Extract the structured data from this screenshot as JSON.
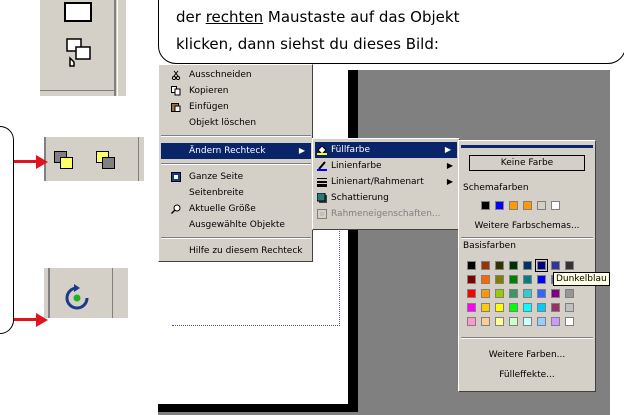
{
  "bubble": {
    "line1_pre": "der ",
    "line1_under": "rechten",
    "line1_post": " Maustaste auf das Objekt",
    "line2": "klicken, dann siehst du dieses Bild:"
  },
  "context_menu": {
    "items": [
      {
        "label": "Ausschneiden",
        "icon": "scissors-icon"
      },
      {
        "label": "Kopieren",
        "icon": "copy-icon"
      },
      {
        "label": "Einfügen",
        "icon": "paste-icon"
      },
      {
        "label": "Objekt löschen",
        "icon": ""
      },
      {
        "label": "Ändern Rechteck",
        "icon": ""
      },
      {
        "label": "Ganze Seite",
        "icon": "page-icon"
      },
      {
        "label": "Seitenbreite",
        "icon": ""
      },
      {
        "label": "Aktuelle Größe",
        "icon": "magnifier-icon"
      },
      {
        "label": "Ausgewählte Objekte",
        "icon": ""
      },
      {
        "label": "Hilfe zu diesem Rechteck",
        "icon": ""
      }
    ]
  },
  "submenu": {
    "items": [
      {
        "label": "Füllfarbe"
      },
      {
        "label": "Linienfarbe"
      },
      {
        "label": "Linienart/Rahmenart"
      },
      {
        "label": "Schattierung"
      },
      {
        "label": "Rahmeneigenschaften..."
      }
    ]
  },
  "palette": {
    "keine": "Keine Farbe",
    "schema_title": "Schemafarben",
    "weitere_schemas": "Weitere Farbschemas...",
    "basis_title": "Basisfarben",
    "tooltip": "Dunkelblau",
    "weitere_farben": "Weitere Farben...",
    "fuelleffekte": "Fülleffekte...",
    "schema_colors": [
      "#000000",
      "#0000ff",
      "#ff9900",
      "#ff9900",
      "#d4d0c8",
      "#ffffff"
    ],
    "basis_colors": [
      [
        "#000000",
        "#993300",
        "#333300",
        "#003300",
        "#003366",
        "#000080",
        "#333399",
        "#333333"
      ],
      [
        "#800000",
        "#ff6600",
        "#808000",
        "#008000",
        "#008080",
        "#0000ff",
        "#666699",
        "#808080"
      ],
      [
        "#ff0000",
        "#ff9900",
        "#99cc00",
        "#339966",
        "#33cccc",
        "#3366ff",
        "#800080",
        "#969696"
      ],
      [
        "#ff00ff",
        "#ffcc00",
        "#ffff00",
        "#00ff00",
        "#00ffff",
        "#00ccff",
        "#993366",
        "#c0c0c0"
      ],
      [
        "#ff99cc",
        "#ffcc99",
        "#ffff99",
        "#ccffcc",
        "#ccffff",
        "#99ccff",
        "#cc99ff",
        "#ffffff"
      ]
    ]
  },
  "colors": {
    "menu_bg": "#d4d0c8",
    "highlight": "#0a246a",
    "arrow": "#e0141e"
  }
}
